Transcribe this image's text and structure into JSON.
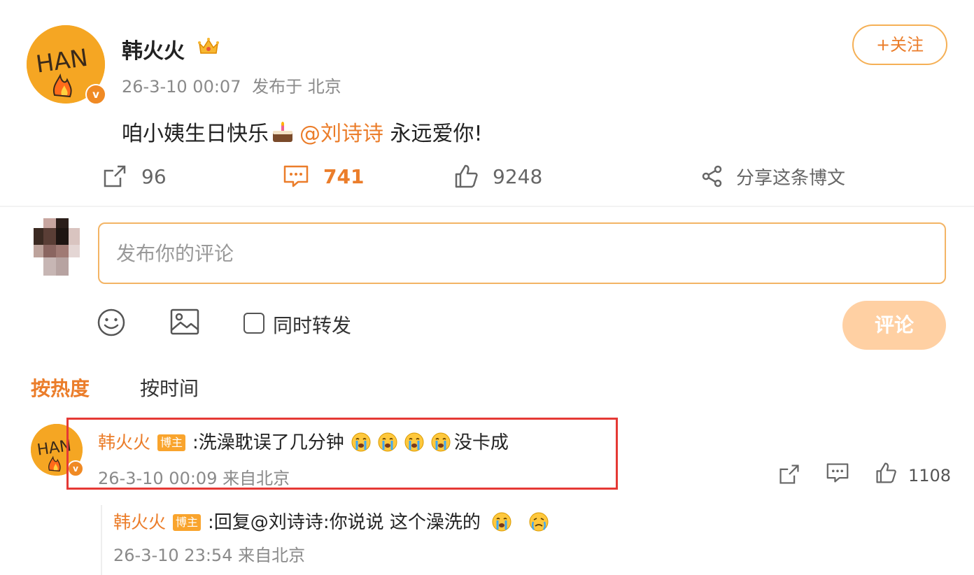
{
  "post": {
    "author": "韩火火",
    "avatar_text": "HAN",
    "time": "26-3-10 00:07",
    "location_prefix": "发布于",
    "location": "北京",
    "follow_label": "+关注",
    "text_before": "咱小姨生日快乐",
    "mention": "@刘诗诗",
    "text_after": "永远爱你!",
    "actions": {
      "repost": "96",
      "comment": "741",
      "like": "9248",
      "share": "分享这条博文"
    }
  },
  "composer": {
    "placeholder": "发布你的评论",
    "repost_checkbox_label": "同时转发",
    "submit_label": "评论"
  },
  "sort": {
    "hot": "按热度",
    "time": "按时间"
  },
  "comment": {
    "author": "韩火火",
    "badge": "博主",
    "text": ":洗澡耽误了几分钟",
    "text_suffix": "没卡成",
    "meta": "26-3-10 00:09 来自北京",
    "like_count": "1108",
    "reply": {
      "author": "韩火火",
      "badge": "博主",
      "prefix": ":回复",
      "mention": "@刘诗诗",
      "text": ":你说说 这个澡洗的",
      "meta": "26-3-10 23:54 来自北京"
    }
  },
  "colors": {
    "accent": "#eb7d2a",
    "highlight": "#e53935",
    "avatar": "#f5a623"
  },
  "icons": [
    "crown-icon",
    "cake-icon",
    "repost-icon",
    "comment-icon",
    "like-icon",
    "share-icon",
    "emoji-icon",
    "image-icon",
    "crying-emoji-icon"
  ]
}
